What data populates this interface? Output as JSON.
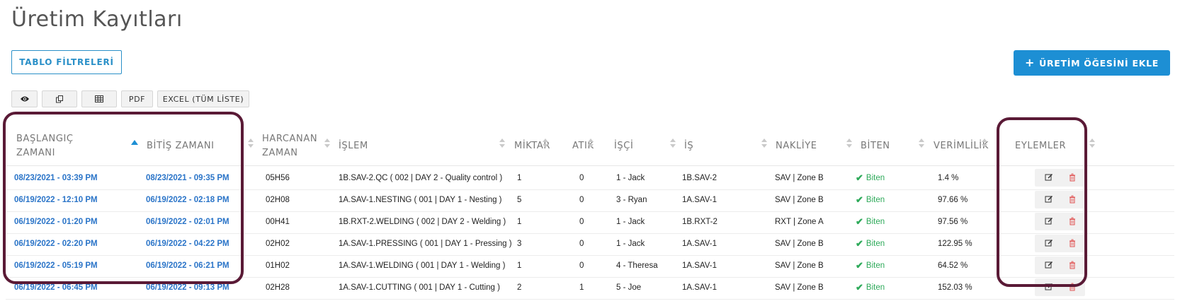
{
  "page": {
    "title": "Üretim Kayıtları"
  },
  "buttons": {
    "filters": "TABLO FİLTRELERİ",
    "add_plus": "+",
    "add_label": "ÜRETİM ÖĞESİNİ EKLE"
  },
  "toolbar": {
    "pdf": "PDF",
    "excel": "EXCEL (TÜM LİSTE)"
  },
  "icons": {
    "visibility": "eye-icon",
    "copy": "copy-icon",
    "csv": "table-icon",
    "edit": "edit-icon",
    "delete": "trash-icon",
    "status": "check-icon"
  },
  "colors": {
    "accent": "#1d8fd4",
    "link": "#2a74c8",
    "status_ok": "#2eaa5a",
    "delete": "#e05050",
    "highlight": "#5a1a36"
  },
  "table": {
    "columns": {
      "start_1": "BAŞLANGIÇ",
      "start_2": "ZAMANI",
      "end": "BİTİŞ ZAMANI",
      "spent_1": "HARCANAN",
      "spent_2": "ZAMAN",
      "operation": "İŞLEM",
      "quantity": "MİKTAR",
      "waste": "ATIK",
      "worker": "İŞÇİ",
      "job": "İŞ",
      "shipping": "NAKLİYE",
      "finished": "BİTEN",
      "efficiency": "VERİMLİLİK",
      "actions": "EYLEMLER"
    },
    "rows": [
      {
        "start": "08/23/2021 - 03:39 PM",
        "end": "08/23/2021 - 09:35 PM",
        "spent": "05H56",
        "operation": "1B.SAV-2.QC ( 002 | DAY 2 - Quality control )",
        "quantity": "1",
        "waste": "0",
        "worker": "1 - Jack",
        "job": "1B.SAV-2",
        "shipping": "SAV | Zone B",
        "status": "Biten",
        "efficiency": "1.4 %"
      },
      {
        "start": "06/19/2022 - 12:10 PM",
        "end": "06/19/2022 - 02:18 PM",
        "spent": "02H08",
        "operation": "1A.SAV-1.NESTING ( 001 | DAY 1 - Nesting )",
        "quantity": "5",
        "waste": "0",
        "worker": "3 - Ryan",
        "job": "1A.SAV-1",
        "shipping": "SAV | Zone B",
        "status": "Biten",
        "efficiency": "97.66 %"
      },
      {
        "start": "06/19/2022 - 01:20 PM",
        "end": "06/19/2022 - 02:01 PM",
        "spent": "00H41",
        "operation": "1B.RXT-2.WELDING ( 002 | DAY 2 - Welding )",
        "quantity": "1",
        "waste": "0",
        "worker": "1 - Jack",
        "job": "1B.RXT-2",
        "shipping": "RXT | Zone A",
        "status": "Biten",
        "efficiency": "97.56 %"
      },
      {
        "start": "06/19/2022 - 02:20 PM",
        "end": "06/19/2022 - 04:22 PM",
        "spent": "02H02",
        "operation": "1A.SAV-1.PRESSING ( 001 | DAY 1 - Pressing )",
        "quantity": "3",
        "waste": "0",
        "worker": "1 - Jack",
        "job": "1A.SAV-1",
        "shipping": "SAV | Zone B",
        "status": "Biten",
        "efficiency": "122.95 %"
      },
      {
        "start": "06/19/2022 - 05:19 PM",
        "end": "06/19/2022 - 06:21 PM",
        "spent": "01H02",
        "operation": "1A.SAV-1.WELDING ( 001 | DAY 1 - Welding )",
        "quantity": "1",
        "waste": "0",
        "worker": "4 - Theresa",
        "job": "1A.SAV-1",
        "shipping": "SAV | Zone B",
        "status": "Biten",
        "efficiency": "64.52 %"
      },
      {
        "start": "06/19/2022 - 06:45 PM",
        "end": "06/19/2022 - 09:13 PM",
        "spent": "02H28",
        "operation": "1A.SAV-1.CUTTING ( 001 | DAY 1 - Cutting )",
        "quantity": "2",
        "waste": "1",
        "worker": "5 - Joe",
        "job": "1A.SAV-1",
        "shipping": "SAV | Zone B",
        "status": "Biten",
        "efficiency": "152.03 %"
      }
    ]
  }
}
